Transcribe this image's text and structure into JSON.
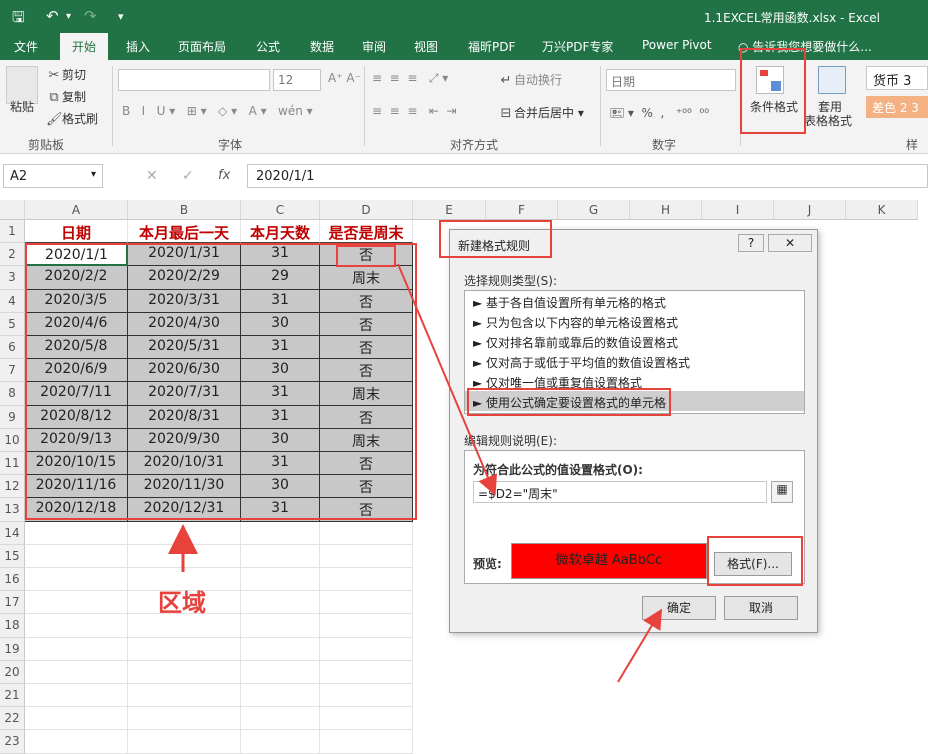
{
  "window": {
    "title": "1.1EXCEL常用函数.xlsx - Excel"
  },
  "tabs": [
    "文件",
    "开始",
    "插入",
    "页面布局",
    "公式",
    "数据",
    "审阅",
    "视图",
    "福昕PDF",
    "万兴PDF专家",
    "Power Pivot"
  ],
  "active_tab": "开始",
  "tell_me": "告诉我您想要做什么...",
  "ribbon": {
    "clipboard": {
      "paste": "粘贴",
      "cut": "剪切",
      "copy": "复制",
      "format_painter": "格式刷",
      "label": "剪贴板"
    },
    "font": {
      "size": "12",
      "label": "字体"
    },
    "alignment": {
      "wrap": "自动换行",
      "merge": "合并后居中",
      "label": "对齐方式"
    },
    "number": {
      "format": "日期",
      "label": "数字"
    },
    "styles": {
      "cond_format": "条件格式",
      "table_format_1": "套用",
      "table_format_2": "表格格式",
      "currency": "货币 3",
      "bad": "差色 2 3",
      "label": "样"
    }
  },
  "formula_bar": {
    "name_box": "A2",
    "formula": "2020/1/1"
  },
  "grid": {
    "columns": [
      "A",
      "B",
      "C",
      "D",
      "E",
      "F",
      "G",
      "H",
      "I",
      "J",
      "K"
    ],
    "headers": [
      "日期",
      "本月最后一天",
      "本月天数",
      "是否是周末"
    ],
    "rows": [
      [
        "2020/1/1",
        "2020/1/31",
        "31",
        "否"
      ],
      [
        "2020/2/2",
        "2020/2/29",
        "29",
        "周末"
      ],
      [
        "2020/3/5",
        "2020/3/31",
        "31",
        "否"
      ],
      [
        "2020/4/6",
        "2020/4/30",
        "30",
        "否"
      ],
      [
        "2020/5/8",
        "2020/5/31",
        "31",
        "否"
      ],
      [
        "2020/6/9",
        "2020/6/30",
        "30",
        "否"
      ],
      [
        "2020/7/11",
        "2020/7/31",
        "31",
        "周末"
      ],
      [
        "2020/8/12",
        "2020/8/31",
        "31",
        "否"
      ],
      [
        "2020/9/13",
        "2020/9/30",
        "30",
        "周末"
      ],
      [
        "2020/10/15",
        "2020/10/31",
        "31",
        "否"
      ],
      [
        "2020/11/16",
        "2020/11/30",
        "30",
        "否"
      ],
      [
        "2020/12/18",
        "2020/12/31",
        "31",
        "否"
      ]
    ],
    "row_numbers": [
      "1",
      "2",
      "3",
      "4",
      "5",
      "6",
      "7",
      "8",
      "9",
      "10",
      "11",
      "12",
      "13",
      "14",
      "15",
      "16",
      "17",
      "18",
      "19",
      "20",
      "21",
      "22",
      "23"
    ]
  },
  "dialog": {
    "title": "新建格式规则",
    "help": "?",
    "close": "✕",
    "select_label": "选择规则类型(S):",
    "rules": [
      "► 基于各自值设置所有单元格的格式",
      "► 只为包含以下内容的单元格设置格式",
      "► 仅对排名靠前或靠后的数值设置格式",
      "► 仅对高于或低于平均值的数值设置格式",
      "► 仅对唯一值或重复值设置格式",
      "► 使用公式确定要设置格式的单元格"
    ],
    "edit_label": "编辑规则说明(E):",
    "formula_label": "为符合此公式的值设置格式(O):",
    "formula": "=$D2=\"周末\"",
    "preview_label": "预览:",
    "preview_text": "微软卓越  AaBbCc",
    "format_button": "格式(F)...",
    "ok_button": "确定",
    "cancel_button": "取消"
  },
  "annotation": {
    "region_label": "区域"
  },
  "colors": {
    "excel_green": "#217346",
    "annot_red": "#e8423c",
    "preview_fill": "#ff0000"
  }
}
